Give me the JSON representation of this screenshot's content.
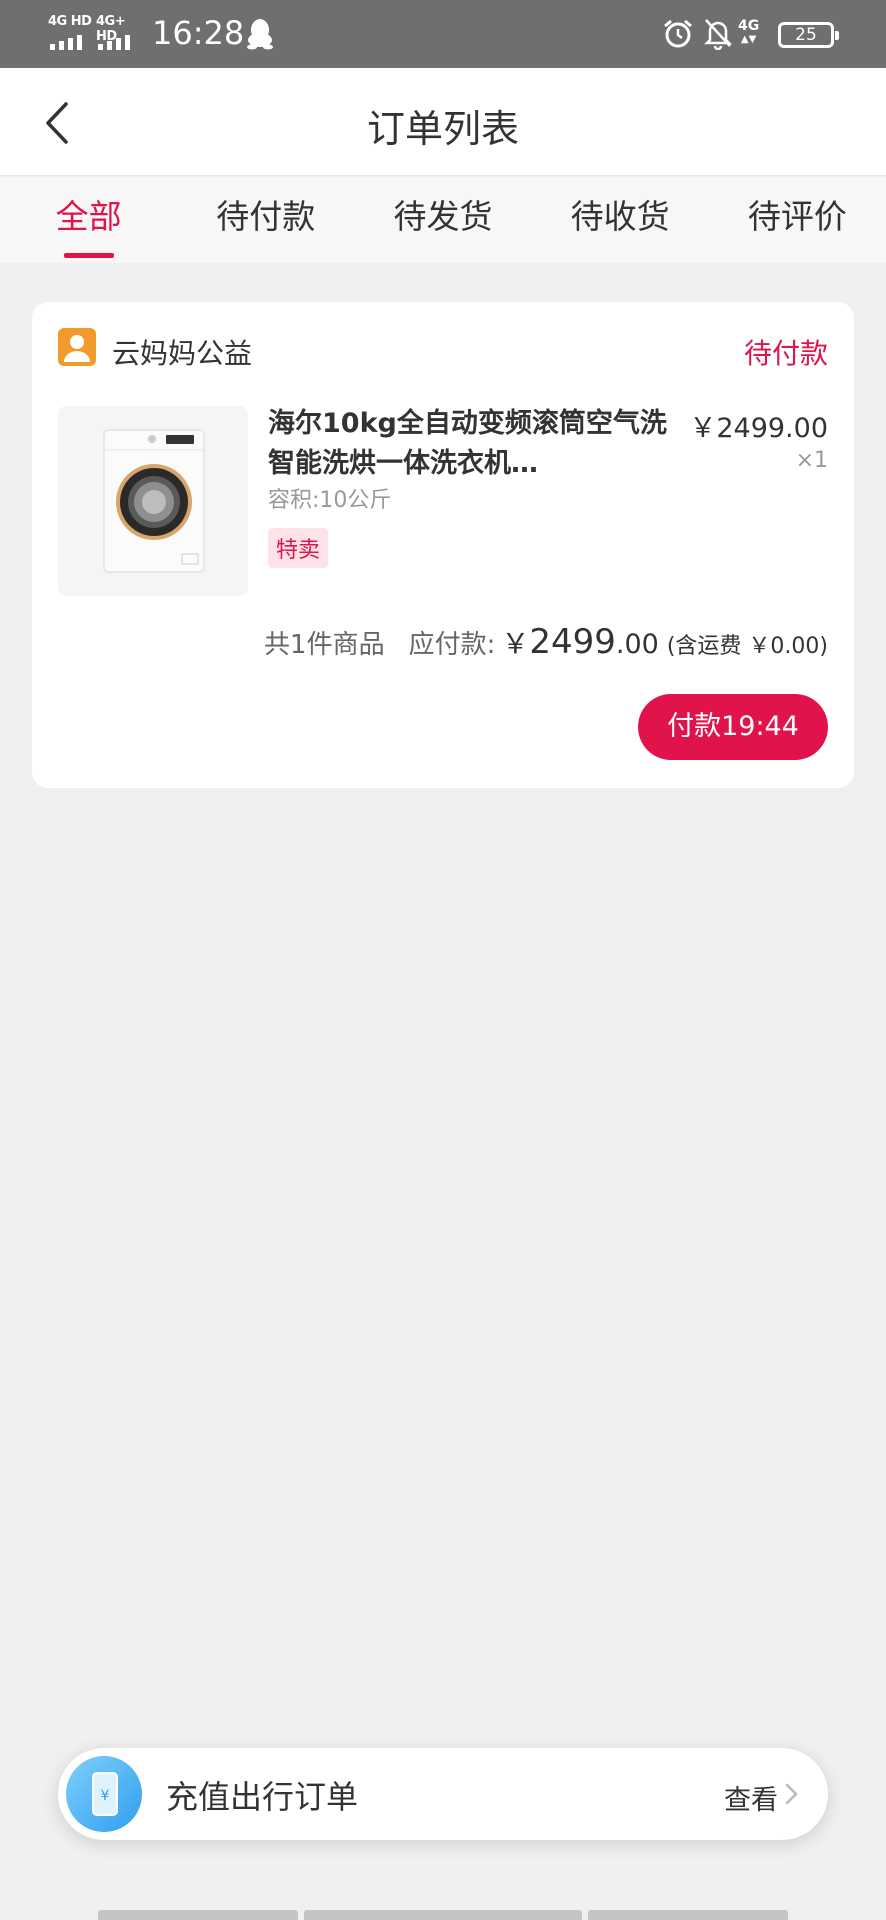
{
  "status_bar": {
    "sim1_label": "4G HD",
    "sim2_label": "4G+ HD",
    "time": "16:28",
    "network_label": "4G",
    "battery": "25"
  },
  "nav": {
    "title": "订单列表"
  },
  "tabs": [
    {
      "label": "全部",
      "active": true
    },
    {
      "label": "待付款",
      "active": false
    },
    {
      "label": "待发货",
      "active": false
    },
    {
      "label": "待收货",
      "active": false
    },
    {
      "label": "待评价",
      "active": false
    }
  ],
  "order": {
    "shop_name": "云妈妈公益",
    "status": "待付款",
    "product": {
      "title": "海尔10kg全自动变频滚筒空气洗智能洗烘一体洗衣机…",
      "spec": "容积:10公斤",
      "tag": "特卖",
      "price": "￥2499.00",
      "qty": "×1"
    },
    "summary": {
      "count_text": "共1件商品",
      "payable_label": "应付款:",
      "currency": "￥",
      "amount_int": "2499",
      "amount_dec": ".00",
      "shipping": "(含运费 ￥0.00)"
    },
    "pay_button": "付款19:44"
  },
  "banner": {
    "text": "充值出行订单",
    "link": "查看",
    "icon": "phone-yuan-icon"
  },
  "colors": {
    "accent": "#e0144b",
    "status_bar_bg": "#6f6f6f",
    "page_bg": "#f0f0f0",
    "shop_icon": "#f39a2c"
  }
}
